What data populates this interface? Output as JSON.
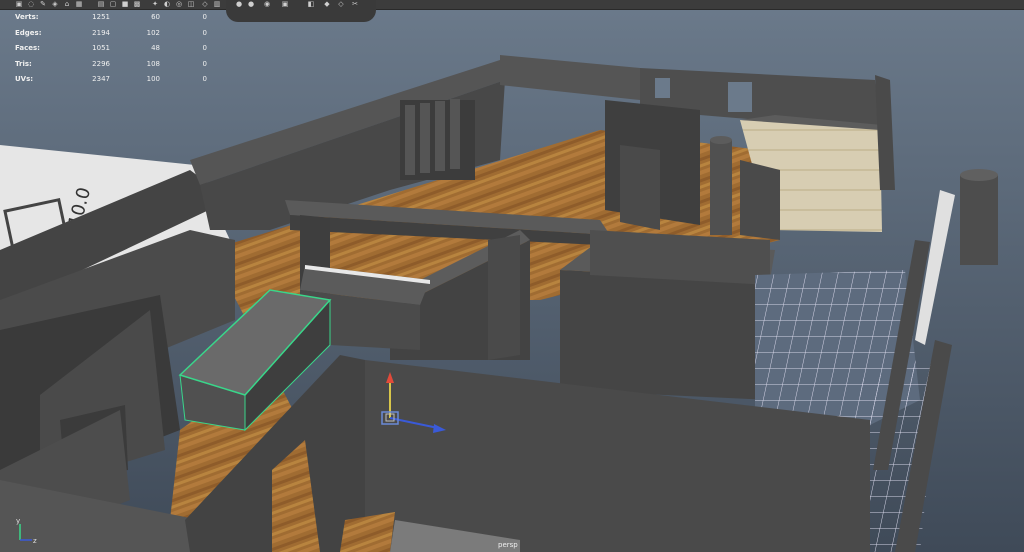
{
  "hud": {
    "rows": [
      {
        "label": "Verts:",
        "c1": "1251",
        "c2": "60",
        "c3": "0"
      },
      {
        "label": "Edges:",
        "c1": "2194",
        "c2": "102",
        "c3": "0"
      },
      {
        "label": "Faces:",
        "c1": "1051",
        "c2": "48",
        "c3": "0"
      },
      {
        "label": "Tris:",
        "c1": "2296",
        "c2": "108",
        "c3": "0"
      },
      {
        "label": "UVs:",
        "c1": "2347",
        "c2": "100",
        "c3": "0"
      }
    ]
  },
  "viewport": {
    "camera_label": "persp",
    "blueprint_text": "10.0",
    "axis_y_label": "y",
    "axis_z_label": "z"
  },
  "toolbar": {
    "icons": [
      "select-icon",
      "lasso-icon",
      "paint-icon",
      "snap-icon",
      "camera-icon",
      "grid-icon",
      "film-icon",
      "wireframe-icon",
      "shaded-icon",
      "textured-icon",
      "light-icon",
      "shadow-icon",
      "isolate-icon",
      "xray-icon",
      "cube-icon",
      "bookmark-icon"
    ]
  },
  "colors": {
    "wall": "#474747",
    "wall_top": "#5c5c5c",
    "floor_wood": "#9a6a34",
    "selection": "#3ad68a",
    "sky": "#5a6a7c",
    "grid": "#d6d6e8"
  }
}
